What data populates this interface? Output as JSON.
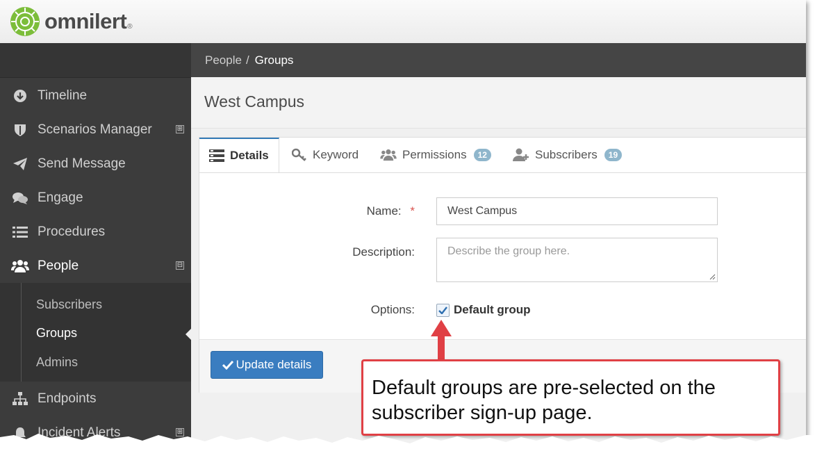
{
  "app": {
    "logo_text": "omnilert",
    "logo_reg": "®",
    "brand_color": "#7cbd3a"
  },
  "sidebar": {
    "items": [
      {
        "label": "Timeline",
        "icon": "arrow-down-circle-icon"
      },
      {
        "label": "Scenarios Manager",
        "icon": "shield-icon",
        "expander": "⊞"
      },
      {
        "label": "Send Message",
        "icon": "paper-plane-icon"
      },
      {
        "label": "Engage",
        "icon": "chat-bubbles-icon"
      },
      {
        "label": "Procedures",
        "icon": "list-icon"
      },
      {
        "label": "People",
        "icon": "users-icon",
        "expander": "⊟"
      },
      {
        "label": "Endpoints",
        "icon": "sitemap-icon"
      },
      {
        "label": "Incident Alerts",
        "icon": "bell-icon",
        "expander": "⊞"
      }
    ],
    "sub_items": [
      {
        "label": "Subscribers"
      },
      {
        "label": "Groups"
      },
      {
        "label": "Admins"
      }
    ]
  },
  "breadcrumb": {
    "first": "People",
    "separator": "/",
    "second": "Groups"
  },
  "page": {
    "title": "West Campus"
  },
  "tabs": [
    {
      "label": "Details",
      "icon": "details-icon"
    },
    {
      "label": "Keyword",
      "icon": "key-icon"
    },
    {
      "label": "Permissions",
      "icon": "users-icon",
      "badge": "12"
    },
    {
      "label": "Subscribers",
      "icon": "add-user-icon",
      "badge": "19"
    }
  ],
  "form": {
    "name_label": "Name:",
    "required_mark": "*",
    "name_value": "West Campus",
    "description_label": "Description:",
    "description_placeholder": "Describe the group here.",
    "options_label": "Options:",
    "default_group_label": "Default group",
    "default_group_checked": true
  },
  "footer": {
    "update_button": "Update details"
  },
  "callout": {
    "text": "Default groups are pre-selected on the subscriber sign-up page.",
    "border_color": "#e04045"
  }
}
